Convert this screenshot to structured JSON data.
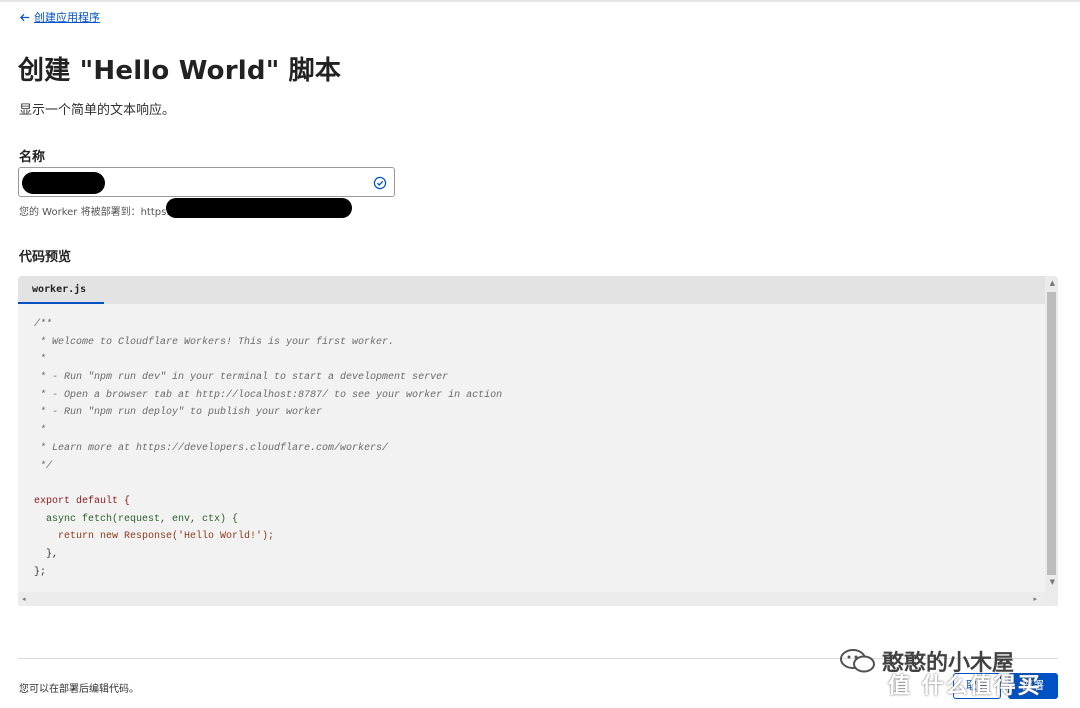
{
  "nav": {
    "back_label": "创建应用程序"
  },
  "page": {
    "title": "创建 \"Hello World\" 脚本",
    "subtitle": "显示一个简单的文本响应。"
  },
  "name_field": {
    "label": "名称",
    "value": "",
    "deploy_note": "您的 Worker 将被部署到：https://"
  },
  "code_preview": {
    "label": "代码预览",
    "tab": "worker.js",
    "lines": [
      "/**",
      " * Welcome to Cloudflare Workers! This is your first worker.",
      " *",
      " * - Run \"npm run dev\" in your terminal to start a development server",
      " * - Open a browser tab at http://localhost:8787/ to see your worker in action",
      " * - Run \"npm run deploy\" to publish your worker",
      " *",
      " * Learn more at https://developers.cloudflare.com/workers/",
      " */",
      "",
      "export default {",
      "  async fetch(request, env, ctx) {",
      "    return new Response('Hello World!');",
      "  },",
      "};"
    ]
  },
  "footer": {
    "note": "您可以在部署后编辑代码。",
    "cancel_label": "取消",
    "deploy_label": "部署"
  },
  "watermark": {
    "text": "憨憨的小木屋",
    "site": "值 什么值得买"
  },
  "colors": {
    "accent": "#0051c3",
    "text": "#313131",
    "editor_bg": "#f2f2f2"
  }
}
